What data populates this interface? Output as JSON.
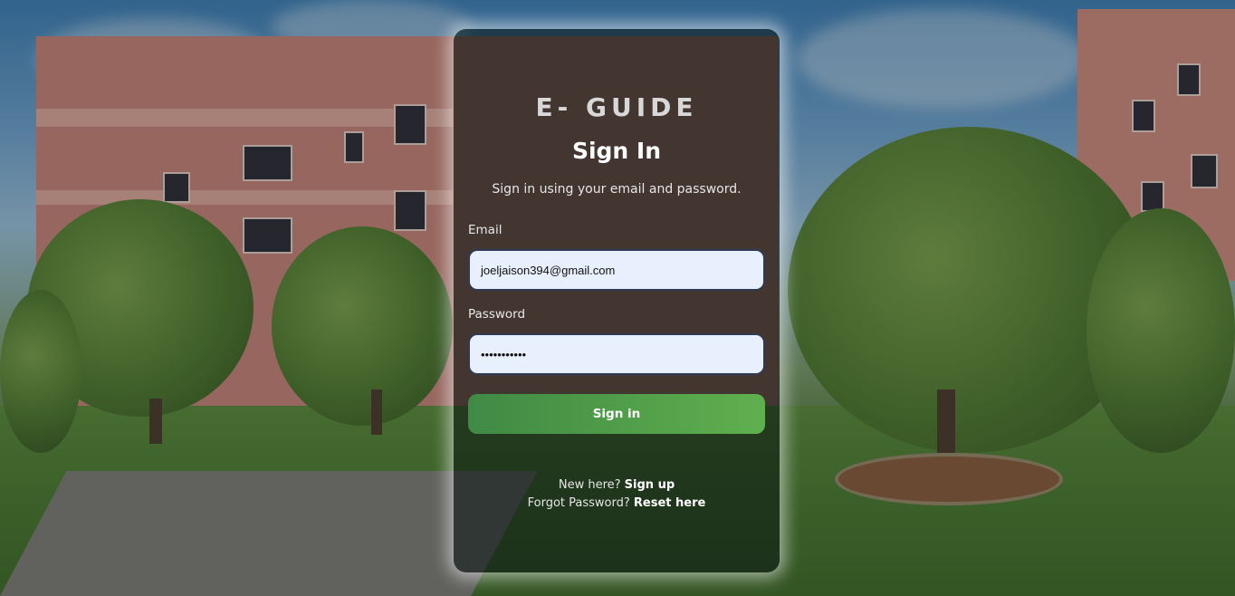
{
  "brand": "E- GUIDE",
  "title": "Sign In",
  "subtitle": "Sign in using your email and password.",
  "form": {
    "email_label": "Email",
    "email_value": "joeljaison394@gmail.com",
    "password_label": "Password",
    "password_value": "•••••••••••",
    "submit_label": "Sign in"
  },
  "footer": {
    "new_here_text": "New here?",
    "signup_link": "Sign up",
    "forgot_text": "Forgot Password?",
    "reset_link": "Reset here"
  },
  "colors": {
    "button_start": "#3f8a45",
    "button_end": "#5fb04e",
    "input_bg": "#e8f0fe",
    "input_border": "#2f3a55"
  }
}
